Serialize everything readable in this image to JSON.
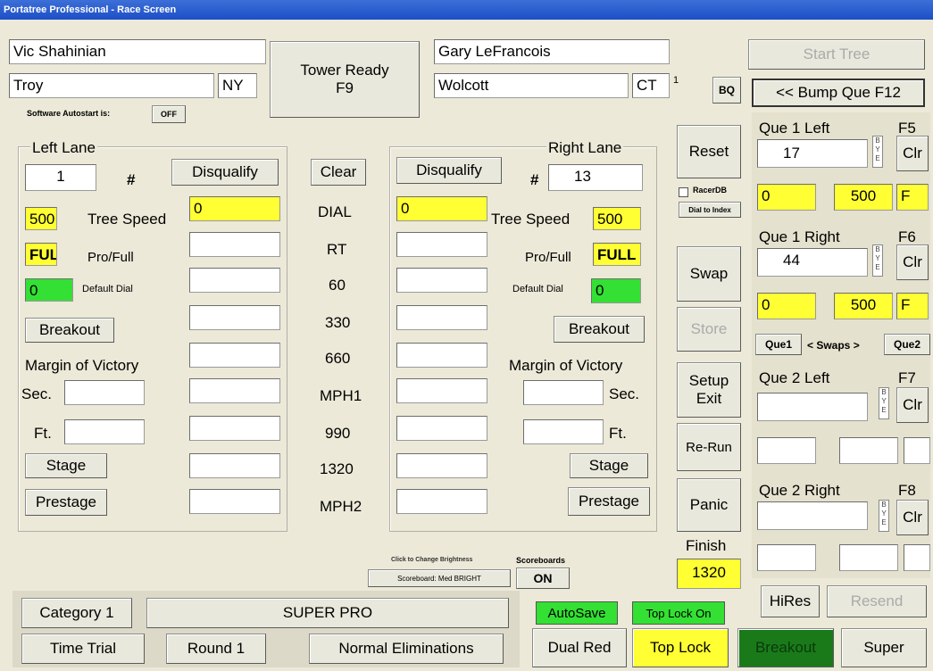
{
  "window": {
    "title": "Portatree Professional - Race Screen"
  },
  "left_racer": {
    "name": "Vic Shahinian",
    "city": "Troy",
    "state": "NY"
  },
  "right_racer": {
    "name": "Gary LeFrancois",
    "city": "Wolcott",
    "state": "CT",
    "note": "1"
  },
  "tower": {
    "line1": "Tower Ready",
    "line2": "F9"
  },
  "autostart": {
    "label": "Software Autostart is:",
    "value": "OFF"
  },
  "bq_label": "BQ",
  "start_tree": "Start Tree",
  "bump_que": "<< Bump Que  F12",
  "left_lane": {
    "title": "Left Lane",
    "number": "1",
    "hash": "#",
    "disqualify": "Disqualify",
    "tree_speed_value": "500",
    "tree_speed_label": "Tree Speed",
    "pro_full_value": "FULL",
    "pro_full_label": "Pro/Full",
    "default_dial_value": "0",
    "default_dial_label": "Default Dial",
    "dial_value": "0",
    "breakout": "Breakout",
    "margin": "Margin of Victory",
    "sec": "Sec.",
    "ft": "Ft.",
    "stage": "Stage",
    "prestage": "Prestage"
  },
  "right_lane": {
    "title": "Right Lane",
    "number": "13",
    "hash": "#",
    "disqualify": "Disqualify",
    "tree_speed_value": "500",
    "tree_speed_label": "Tree Speed",
    "pro_full_value": "FULL",
    "pro_full_label": "Pro/Full",
    "default_dial_value": "0",
    "default_dial_label": "Default Dial",
    "dial_value": "0",
    "breakout": "Breakout",
    "margin": "Margin of Victory",
    "sec": "Sec.",
    "ft": "Ft.",
    "stage": "Stage",
    "prestage": "Prestage"
  },
  "center": {
    "clear": "Clear",
    "rows": [
      "DIAL",
      "RT",
      "60",
      "330",
      "660",
      "MPH1",
      "990",
      "1320",
      "MPH2"
    ]
  },
  "side_buttons": {
    "reset": "Reset",
    "racerdb": "RacerDB",
    "dial_to_index": "Dial to Index",
    "swap": "Swap",
    "store": "Store",
    "setup": "Setup",
    "exit": "Exit",
    "rerun": "Re-Run",
    "panic": "Panic",
    "finish_label": "Finish",
    "finish_value": "1320"
  },
  "que1_left": {
    "title": "Que 1 Left",
    "key": "F5",
    "number": "17",
    "dial": "0",
    "speed": "500",
    "mode": "F",
    "clr": "Clr",
    "bye": "BYE"
  },
  "que1_right": {
    "title": "Que 1 Right",
    "key": "F6",
    "number": "44",
    "dial": "0",
    "speed": "500",
    "mode": "F",
    "clr": "Clr",
    "bye": "BYE"
  },
  "swaps": {
    "que1": "Que1",
    "middle": "< Swaps >",
    "que2": "Que2"
  },
  "que2_left": {
    "title": "Que 2 Left",
    "key": "F7",
    "clr": "Clr",
    "bye": "BYE"
  },
  "que2_right": {
    "title": "Que 2 Right",
    "key": "F8",
    "clr": "Clr",
    "bye": "BYE"
  },
  "scoreboard": {
    "brightness_hint": "Click to Change Brightness",
    "brightness_button": "Scoreboard: Med BRIGHT",
    "label": "Scoreboards",
    "value": "ON"
  },
  "hires": "HiRes",
  "resend": "Resend",
  "bottom": {
    "category": "Category 1",
    "class_name": "SUPER PRO",
    "time_trial": "Time Trial",
    "round": "Round 1",
    "elim_type": "Normal Eliminations",
    "autosave": "AutoSave",
    "top_lock_on": "Top Lock On",
    "dual_red": "Dual Red",
    "top_lock": "Top Lock",
    "breakout": "Breakout",
    "super": "Super"
  },
  "colors": {
    "yellow": "#ffff33",
    "green": "#33e033",
    "dark_green": "#1a7a1a",
    "title_blue": "#1c4fc6"
  }
}
